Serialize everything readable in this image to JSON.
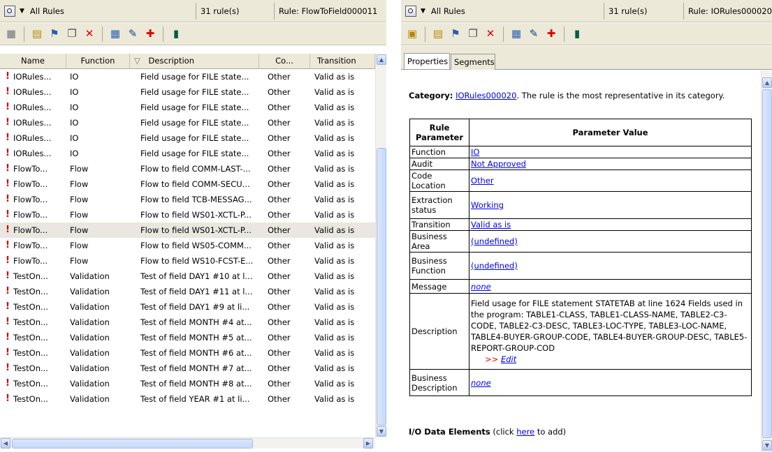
{
  "left": {
    "scope": "All Rules",
    "count": "31 rule(s)",
    "current_rule": "Rule: FlowToField000011",
    "columns": [
      "Name",
      "Function",
      "Description",
      "Co...",
      "Transition"
    ],
    "sort_indicator": "▽",
    "rows": [
      [
        "IORules...",
        "IO",
        "Field usage for FILE state...",
        "Other",
        "Valid as is"
      ],
      [
        "IORules...",
        "IO",
        "Field usage for FILE state...",
        "Other",
        "Valid as is"
      ],
      [
        "IORules...",
        "IO",
        "Field usage for FILE state...",
        "Other",
        "Valid as is"
      ],
      [
        "IORules...",
        "IO",
        "Field usage for FILE state...",
        "Other",
        "Valid as is"
      ],
      [
        "IORules...",
        "IO",
        "Field usage for FILE state...",
        "Other",
        "Valid as is"
      ],
      [
        "IORules...",
        "IO",
        "Field usage for FILE state...",
        "Other",
        "Valid as is"
      ],
      [
        "FlowTo...",
        "Flow",
        "Flow to field COMM-LAST-...",
        "Other",
        "Valid as is"
      ],
      [
        "FlowTo...",
        "Flow",
        "Flow to field COMM-SECU...",
        "Other",
        "Valid as is"
      ],
      [
        "FlowTo...",
        "Flow",
        "Flow to field TCB-MESSAG...",
        "Other",
        "Valid as is"
      ],
      [
        "FlowTo...",
        "Flow",
        "Flow to field WS01-XCTL-P...",
        "Other",
        "Valid as is"
      ],
      [
        "FlowTo...",
        "Flow",
        "Flow to field WS01-XCTL-P...",
        "Other",
        "Valid as is"
      ],
      [
        "FlowTo...",
        "Flow",
        "Flow to field WS05-COMM...",
        "Other",
        "Valid as is"
      ],
      [
        "FlowTo...",
        "Flow",
        "Flow to field WS10-FCST-E...",
        "Other",
        "Valid as is"
      ],
      [
        "TestOn...",
        "Validation",
        "Test of field DAY1 #10 at l...",
        "Other",
        "Valid as is"
      ],
      [
        "TestOn...",
        "Validation",
        "Test of field DAY1 #11 at l...",
        "Other",
        "Valid as is"
      ],
      [
        "TestOn...",
        "Validation",
        "Test of field DAY1 #9 at li...",
        "Other",
        "Valid as is"
      ],
      [
        "TestOn...",
        "Validation",
        "Test of field MONTH #4 at...",
        "Other",
        "Valid as is"
      ],
      [
        "TestOn...",
        "Validation",
        "Test of field MONTH #5 at...",
        "Other",
        "Valid as is"
      ],
      [
        "TestOn...",
        "Validation",
        "Test of field MONTH #6 at...",
        "Other",
        "Valid as is"
      ],
      [
        "TestOn...",
        "Validation",
        "Test of field MONTH #7 at...",
        "Other",
        "Valid as is"
      ],
      [
        "TestOn...",
        "Validation",
        "Test of field MONTH #8 at...",
        "Other",
        "Valid as is"
      ],
      [
        "TestOn...",
        "Validation",
        "Test of field YEAR #1 at li...",
        "Other",
        "Valid as is"
      ]
    ],
    "selected_row_index": 10
  },
  "right": {
    "scope": "All Rules",
    "count": "31 rule(s)",
    "current_rule": "Rule: IORules000020",
    "tabs": [
      "Properties",
      "Segments"
    ],
    "category_label": "Category:",
    "category_link": "IORules000020",
    "category_note": ". The rule is the most representative in its category.",
    "table_headers": [
      "Rule Parameter",
      "Parameter Value"
    ],
    "params": [
      {
        "name": "Function",
        "value": "IO"
      },
      {
        "name": "Audit",
        "value": "Not Approved"
      },
      {
        "name": "Code Location",
        "value": "Other"
      },
      {
        "name": "Extraction status",
        "value": "Working"
      },
      {
        "name": "Transition",
        "value": "Valid as is"
      },
      {
        "name": "Business Area",
        "value": "(undefined)"
      },
      {
        "name": "Business Function",
        "value": "(undefined)"
      },
      {
        "name": "Message",
        "value": "none"
      }
    ],
    "description_label": "Description",
    "description_text": "Field usage for FILE statement STATETAB  at line 1624 Fields used in the program: TABLE1-CLASS, TABLE1-CLASS-NAME, TABLE2-C3-CODE, TABLE2-C3-DESC, TABLE3-LOC-TYPE, TABLE3-LOC-NAME, TABLE4-BUYER-GROUP-CODE, TABLE4-BUYER-GROUP-DESC, TABLE5-REPORT-GROUP-COD",
    "edit_prefix": ">> ",
    "edit_label": "Edit",
    "business_description_label": "Business Description",
    "business_description_value": "none",
    "io_title": "I/O Data Elements",
    "io_pre": " (click ",
    "io_link": "here",
    "io_post": " to add)"
  },
  "colors": {
    "toolbar_bg": "#ece9d8",
    "link": "#0000ee",
    "alert": "#d40000",
    "selected_row": "#e9e7e0"
  }
}
